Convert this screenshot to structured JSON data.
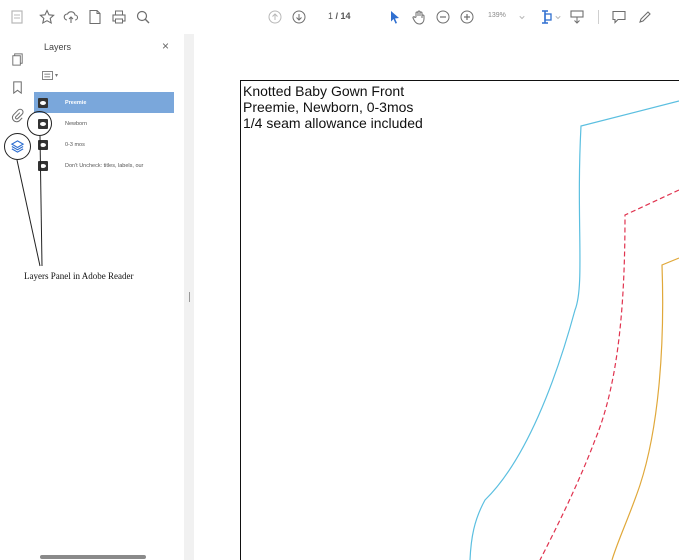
{
  "toolbar": {
    "page_current": "1",
    "page_total": "/ 14",
    "zoom_level": "139%"
  },
  "layers_panel": {
    "title": "Layers",
    "close": "×",
    "options_arrow": "▾",
    "layers": [
      {
        "label": "Preemie"
      },
      {
        "label": "Newborn"
      },
      {
        "label": "0-3 mos"
      },
      {
        "label": "Don't Uncheck: titles, labels, our"
      }
    ]
  },
  "annotation": {
    "text": "Layers Panel in Adobe Reader"
  },
  "document": {
    "lines": [
      "Knotted Baby Gown Front",
      "Preemie, Newborn, 0-3mos",
      "1/4 seam allowance included"
    ]
  },
  "colors": {
    "selected_layer": "#7aa7db",
    "preemie_line": "#5bbfe0",
    "newborn_line": "#e0334f",
    "mos_line": "#e0a83a",
    "active_tool": "#2f6fd0"
  }
}
